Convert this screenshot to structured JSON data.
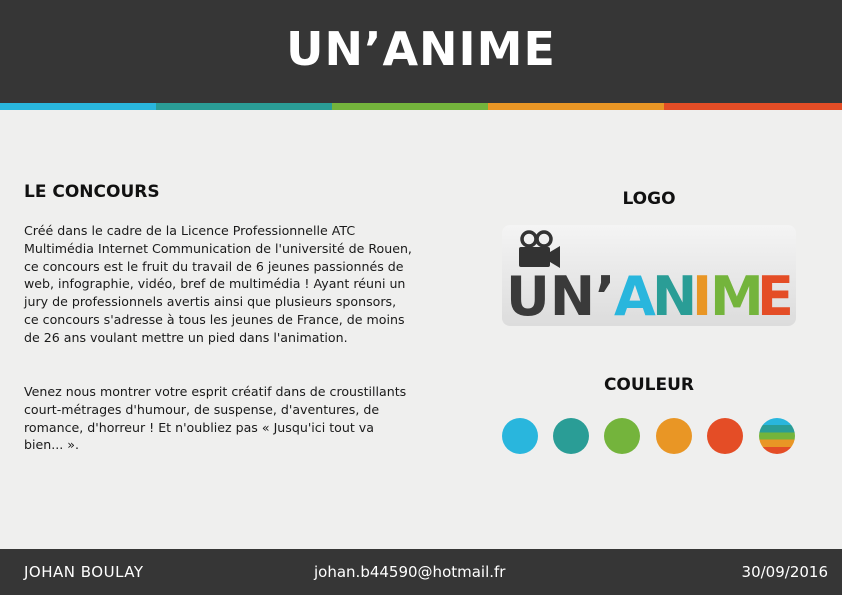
{
  "header": {
    "title": "UN’ANIME"
  },
  "colors": {
    "header_bg": "#363636",
    "page_bg": "#efefee",
    "palette": [
      "#29b6dd",
      "#2a9d96",
      "#74b43c",
      "#e99625",
      "#e44d26"
    ]
  },
  "concours": {
    "title": "LE CONCOURS",
    "paragraph1": "Créé dans le cadre de la Licence Professionnelle ATC Multimédia Internet Communication de l'université de Rouen, ce concours est le fruit du travail de 6 jeunes passionnés de web, infographie, vidéo, bref de multimédia ! Ayant réuni un jury de professionnels avertis ainsi que plusieurs sponsors, ce concours s'adresse à tous les jeunes de France, de moins de 26 ans voulant mettre un pied dans l'animation.",
    "paragraph2": "Venez nous montrer votre esprit créatif dans de croustillants court-métrages d'humour, de suspense, d'aventures, de romance, d'horreur ! Et n'oubliez pas « Jusqu'ici tout va bien... »."
  },
  "logo": {
    "title": "LOGO",
    "icon": "film-camera-icon",
    "wordmark_part1": "UN’",
    "wordmark_part2": "ANIME"
  },
  "couleur": {
    "title": "COULEUR"
  },
  "footer": {
    "name": "JOHAN BOULAY",
    "email": "johan.b44590@hotmail.fr",
    "date": "30/09/2016"
  }
}
